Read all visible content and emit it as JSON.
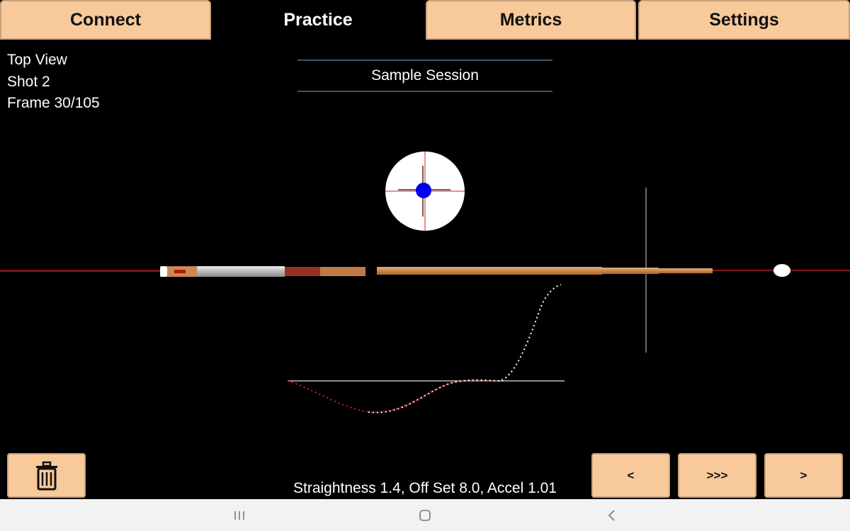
{
  "tabs": [
    {
      "label": "Connect",
      "active": false
    },
    {
      "label": "Practice",
      "active": true
    },
    {
      "label": "Metrics",
      "active": false
    },
    {
      "label": "Settings",
      "active": false
    }
  ],
  "info": {
    "view": "Top View",
    "shot": "Shot 2",
    "frame": "Frame 30/105"
  },
  "session": {
    "title": "Sample Session"
  },
  "controls": {
    "delete_icon": "trash-icon",
    "prev_label": "<",
    "play_label": ">>>",
    "next_label": ">"
  },
  "stats": {
    "text": "Straightness 1.4, Off Set 8.0, Accel 1.01"
  },
  "colors": {
    "tab_bg": "#f8c99a",
    "tab_border": "#c9a27c",
    "tip_marker": "#0000ee",
    "crosshair": "#cc2222"
  },
  "navbar": {
    "recents_icon": "recents-icon",
    "home_icon": "home-icon",
    "back_icon": "back-icon"
  }
}
